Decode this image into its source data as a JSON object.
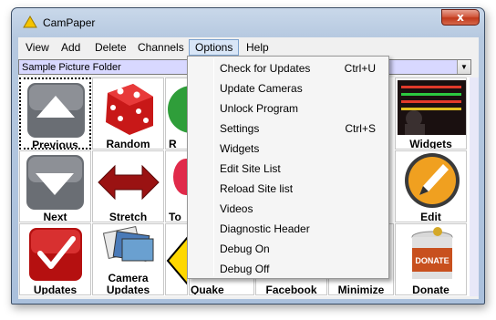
{
  "window": {
    "title": "CamPaper",
    "close_glyph": "x",
    "app_icon": "campaper-triangle-icon"
  },
  "menubar": {
    "items": [
      "View",
      "Add",
      "Delete",
      "Channels",
      "Options",
      "Help"
    ],
    "active": "Options"
  },
  "folder": {
    "value": "Sample Picture Folder",
    "dropdown_glyph": "▼"
  },
  "tiles": [
    {
      "label": "Previous",
      "icon": "arrow-up-icon"
    },
    {
      "label": "Random",
      "icon": "dice-icon"
    },
    {
      "label": "R",
      "icon": "green-circle-icon"
    },
    {
      "label": "Widgets",
      "icon": "stock-ticker-icon"
    },
    {
      "label": "Next",
      "icon": "arrow-down-icon"
    },
    {
      "label": "Stretch",
      "icon": "stretch-arrows-icon"
    },
    {
      "label": "To",
      "icon": "balloon-icon"
    },
    {
      "label": "Edit",
      "icon": "pencil-icon"
    },
    {
      "label": "Updates",
      "icon": "checkmark-icon"
    },
    {
      "label": "Camera Updates",
      "label_line1": "Camera",
      "label_line2": "Updates",
      "icon": "photo-stack-icon"
    },
    {
      "label": "Quake",
      "icon": "warning-sign-icon"
    },
    {
      "label": "Facebook",
      "icon": "facebook-icon"
    },
    {
      "label": "Minimize",
      "icon": "minimize-icon"
    },
    {
      "label": "Donate",
      "icon": "donate-can-icon",
      "can_text": "DONATE"
    }
  ],
  "options_menu": [
    {
      "label": "Check for Updates",
      "shortcut": "Ctrl+U"
    },
    {
      "label": "Update Cameras",
      "shortcut": ""
    },
    {
      "label": "Unlock Program",
      "shortcut": ""
    },
    {
      "label": "Settings",
      "shortcut": "Ctrl+S"
    },
    {
      "label": "Widgets",
      "shortcut": ""
    },
    {
      "label": "Edit Site List",
      "shortcut": ""
    },
    {
      "label": "Reload Site list",
      "shortcut": ""
    },
    {
      "label": "Videos",
      "shortcut": ""
    },
    {
      "label": "Diagnostic Header",
      "shortcut": ""
    },
    {
      "label": "Debug On",
      "shortcut": ""
    },
    {
      "label": "Debug Off",
      "shortcut": ""
    }
  ],
  "colors": {
    "folder_bg": "#d8d8ff",
    "menu_highlight": "#d9e6f7",
    "dice_red": "#d42020",
    "checkmark_red": "#c81414"
  }
}
